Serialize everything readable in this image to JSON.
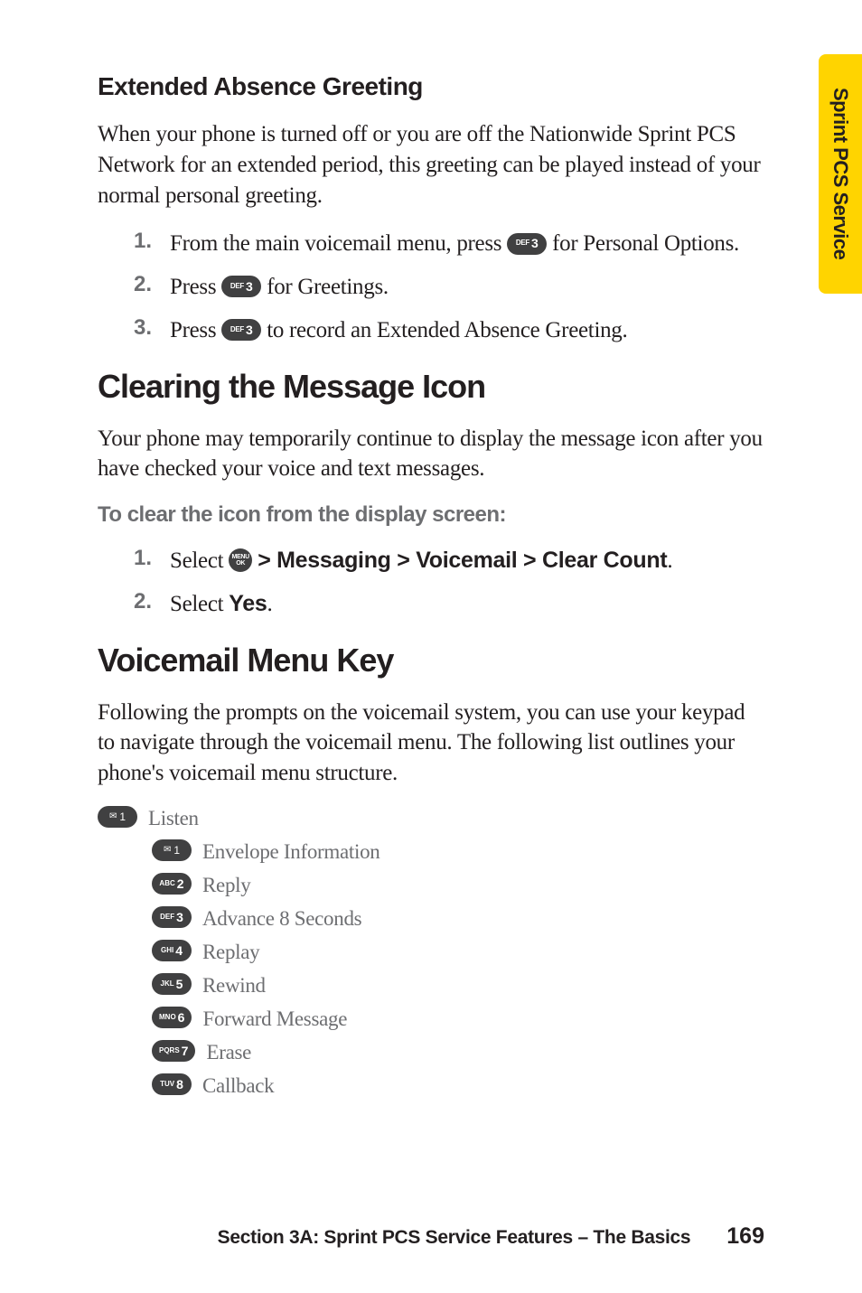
{
  "sideTab": "Sprint PCS Service",
  "sections": {
    "extended": {
      "title": "Extended Absence Greeting",
      "intro": "When your phone is turned off or you are off the Nationwide Sprint PCS Network for an extended period, this greeting can be played instead of your normal personal greeting.",
      "steps": [
        {
          "num": "1.",
          "pre": "From the main voicemail menu, press ",
          "key": {
            "sup": "DEF",
            "main": "3"
          },
          "post": " for Personal Options."
        },
        {
          "num": "2.",
          "pre": "Press ",
          "key": {
            "sup": "DEF",
            "main": "3"
          },
          "post": " for Greetings."
        },
        {
          "num": "3.",
          "pre": "Press ",
          "key": {
            "sup": "DEF",
            "main": "3"
          },
          "post": " to record an Extended Absence Greeting."
        }
      ]
    },
    "clearing": {
      "title": "Clearing the Message Icon",
      "intro": "Your phone may temporarily continue to display the message icon after you have checked your voice and text messages.",
      "subhead": "To clear the icon from the display screen:",
      "steps": [
        {
          "num": "1.",
          "pre": "Select ",
          "menuIcon": {
            "top": "MENU",
            "bottom": "OK"
          },
          "boldPost": " > Messaging > Voicemail > Clear Count",
          "post": "."
        },
        {
          "num": "2.",
          "pre": "Select ",
          "boldPost": "Yes",
          "post": "."
        }
      ]
    },
    "menukey": {
      "title": "Voicemail Menu Key",
      "intro": "Following the prompts on the voicemail system, you can use your keypad to navigate through the voicemail menu. The following list outlines your phone's voicemail menu structure.",
      "top": {
        "key": {
          "env": true,
          "main": "1"
        },
        "label": "Listen"
      },
      "items": [
        {
          "key": {
            "env": true,
            "main": "1"
          },
          "label": "Envelope Information"
        },
        {
          "key": {
            "sup": "ABC",
            "main": "2"
          },
          "label": "Reply"
        },
        {
          "key": {
            "sup": "DEF",
            "main": "3"
          },
          "label": "Advance 8 Seconds"
        },
        {
          "key": {
            "sup": "GHI",
            "main": "4"
          },
          "label": "Replay"
        },
        {
          "key": {
            "sup": "JKL",
            "main": "5"
          },
          "label": "Rewind"
        },
        {
          "key": {
            "sup": "MNO",
            "main": "6"
          },
          "label": "Forward Message"
        },
        {
          "key": {
            "sup": "PQRS",
            "main": "7"
          },
          "label": "Erase"
        },
        {
          "key": {
            "sup": "TUV",
            "main": "8"
          },
          "label": "Callback"
        }
      ]
    }
  },
  "footer": {
    "text": "Section 3A: Sprint PCS Service Features – The Basics",
    "page": "169"
  }
}
